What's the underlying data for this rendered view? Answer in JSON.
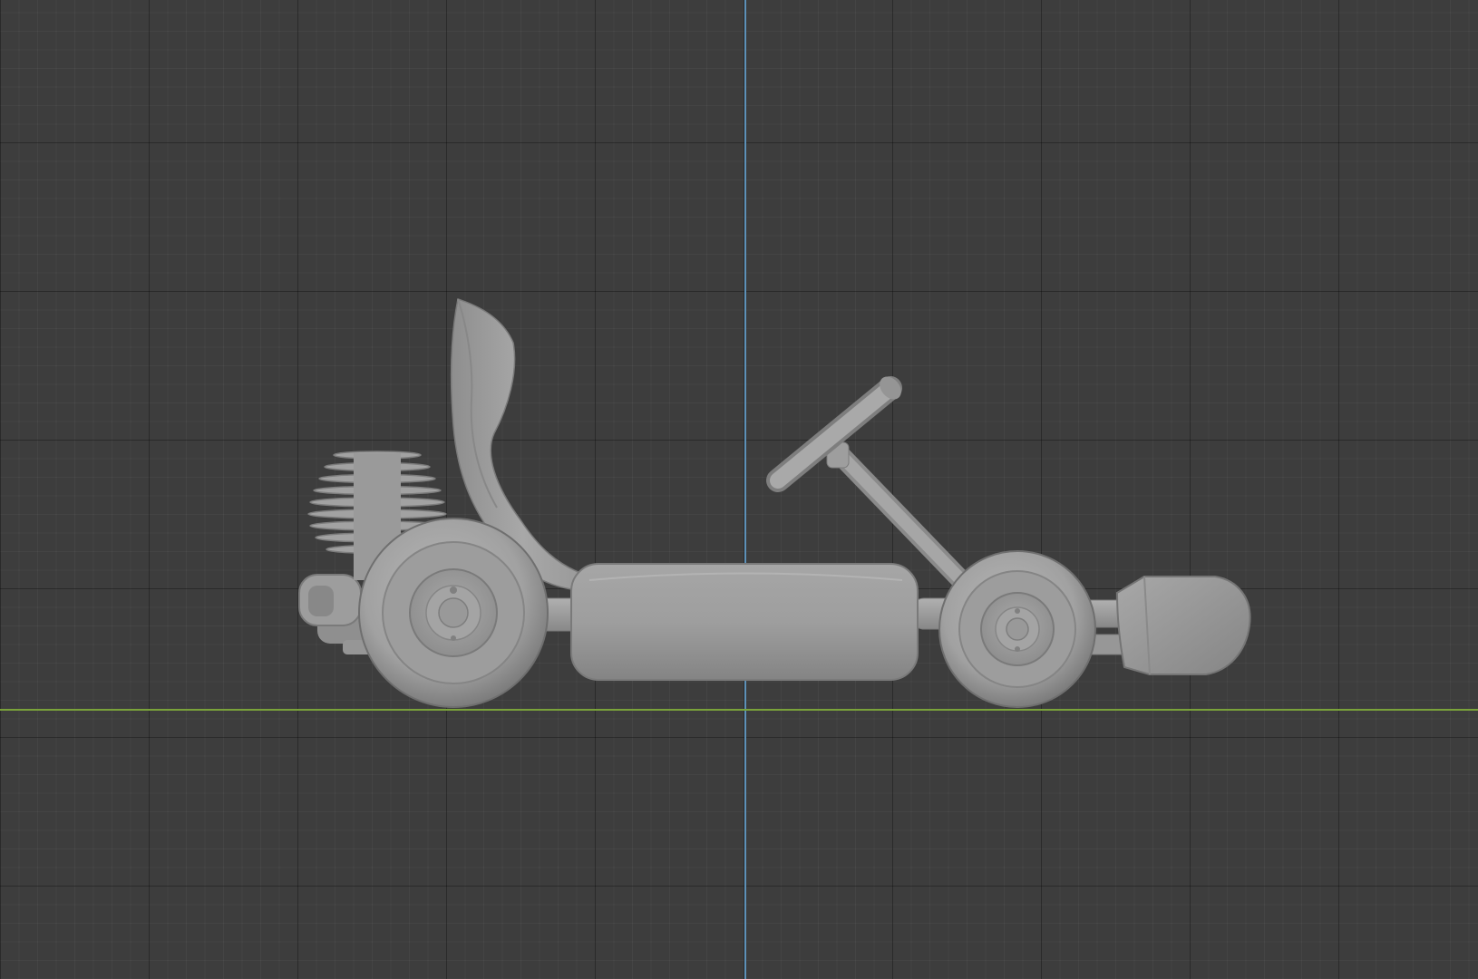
{
  "viewport": {
    "background": "#3d3d3d",
    "axis_colors": {
      "z_axis": "#5d91b8",
      "y_axis": "#7aa33a"
    }
  },
  "model": {
    "object_name": "",
    "shading": "solid",
    "material_color": "#a3a3a3",
    "parts": [
      "engine-cylinder",
      "seat",
      "rear-wheel",
      "front-wheel",
      "side-pod",
      "steering-wheel",
      "steering-column",
      "front-bumper",
      "exhaust"
    ]
  }
}
